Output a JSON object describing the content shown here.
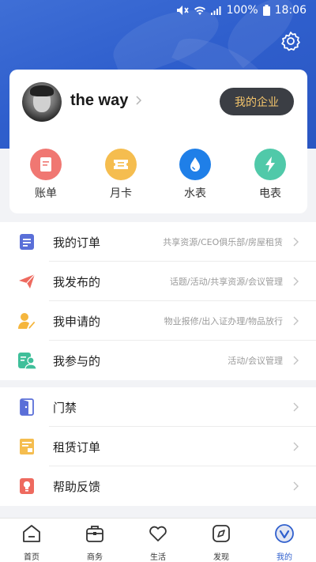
{
  "status_bar": {
    "battery": "100%",
    "time": "18:06"
  },
  "profile": {
    "username": "the way",
    "enterprise_button": "我的企业"
  },
  "quick_actions": [
    {
      "label": "账单",
      "icon": "bill-icon",
      "color": "#f07772"
    },
    {
      "label": "月卡",
      "icon": "ticket-icon",
      "color": "#f5bd4f"
    },
    {
      "label": "水表",
      "icon": "water-drop-icon",
      "color": "#1f7fe8"
    },
    {
      "label": "电表",
      "icon": "lightning-icon",
      "color": "#50c9a9"
    }
  ],
  "menu_group_1": [
    {
      "label": "我的订单",
      "desc": "共享资源/CEO俱乐部/房屋租赁",
      "icon": "order-icon"
    },
    {
      "label": "我发布的",
      "desc": "话题/活动/共享资源/会议管理",
      "icon": "send-icon"
    },
    {
      "label": "我申请的",
      "desc": "物业报修/出入证办理/物品放行",
      "icon": "apply-icon"
    },
    {
      "label": "我参与的",
      "desc": "活动/会议管理",
      "icon": "participate-icon"
    }
  ],
  "menu_group_2": [
    {
      "label": "门禁",
      "icon": "door-icon"
    },
    {
      "label": "租赁订单",
      "icon": "lease-icon"
    },
    {
      "label": "帮助反馈",
      "icon": "feedback-icon"
    }
  ],
  "tabbar": [
    {
      "label": "首页",
      "icon": "home-icon"
    },
    {
      "label": "商务",
      "icon": "briefcase-icon"
    },
    {
      "label": "生活",
      "icon": "heart-icon"
    },
    {
      "label": "发现",
      "icon": "compass-icon"
    },
    {
      "label": "我的",
      "icon": "profile-icon"
    }
  ],
  "colors": {
    "header": "#2f5fcd",
    "enterprise_text": "#f3c46b",
    "active_tab": "#2f5fcd"
  }
}
